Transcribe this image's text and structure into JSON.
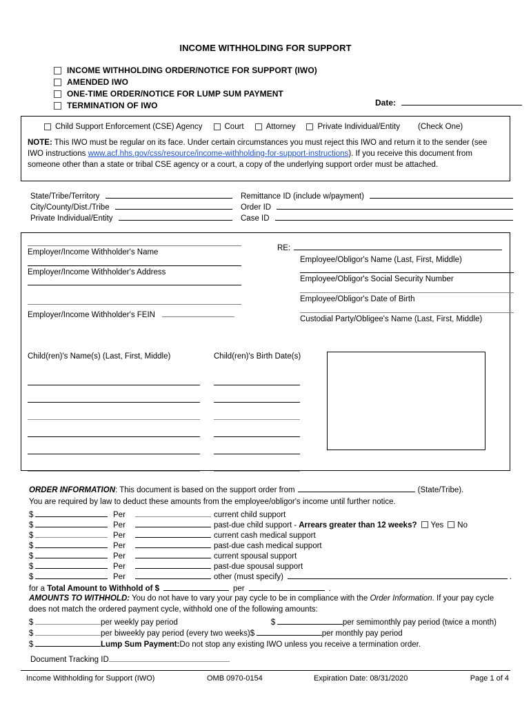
{
  "document": {
    "title": "INCOME WITHHOLDING FOR SUPPORT"
  },
  "form_type_checkboxes": [
    {
      "label": "INCOME WITHHOLDING ORDER/NOTICE FOR SUPPORT (IWO)",
      "checked": false
    },
    {
      "label": "AMENDED IWO",
      "checked": false
    },
    {
      "label": "ONE-TIME ORDER/NOTICE FOR LUMP SUM PAYMENT",
      "checked": false
    },
    {
      "label": "TERMINATION OF IWO",
      "checked": false
    }
  ],
  "date_field": {
    "label": "Date:",
    "value": ""
  },
  "sender_type": {
    "options": [
      "Child Support Enforcement (CSE) Agency",
      "Court",
      "Attorney",
      "Private Individual/Entity"
    ],
    "hint": "(Check One)"
  },
  "note": {
    "label": "NOTE:",
    "part1": "  This IWO must be regular on its face.  Under certain circumstances you must reject this IWO and return it to the sender (see IWO instructions ",
    "link": "www.acf.hhs.gov/css/resource/income-withholding-for-support-instructions",
    "part2": "). If you receive this document from someone other than a state or tribal CSE agency or a court, a copy of the underlying support order must be attached."
  },
  "issuer_block": {
    "rows": [
      {
        "left_label": "State/Tribe/Territory",
        "left_value": "",
        "right_label": "Remittance ID (include w/payment)",
        "right_value": ""
      },
      {
        "left_label": "City/County/Dist./Tribe",
        "left_value": "",
        "right_label": "Order ID",
        "right_value": ""
      },
      {
        "left_label": "Private Individual/Entity",
        "left_value": "",
        "right_label": "Case ID",
        "right_value": ""
      }
    ]
  },
  "employer_block": {
    "left_fields": [
      {
        "label": "Employer/Income Withholder's Name",
        "value": ""
      },
      {
        "label": "Employer/Income Withholder's Address",
        "value": ""
      }
    ],
    "fein": {
      "label": "Employer/Income Withholder's FEIN",
      "value": ""
    },
    "re_label": "RE:",
    "re_value": "",
    "right_fields": [
      {
        "label": "Employee/Obligor's Name (Last, First, Middle)",
        "value": ""
      },
      {
        "label": "Employee/Obligor's Social Security Number",
        "value": ""
      },
      {
        "label": "Employee/Obligor's Date of Birth",
        "value": ""
      },
      {
        "label": "Custodial Party/Obligee's Name (Last, First, Middle)",
        "value": ""
      }
    ],
    "children": {
      "names_header": "Child(ren)'s Name(s) (Last, First, Middle)",
      "birthdates_header": "Child(ren)'s Birth Date(s)",
      "rows": [
        {
          "name": "",
          "birthdate": ""
        },
        {
          "name": "",
          "birthdate": ""
        },
        {
          "name": "",
          "birthdate": ""
        },
        {
          "name": "",
          "birthdate": ""
        },
        {
          "name": "",
          "birthdate": ""
        },
        {
          "name": "",
          "birthdate": ""
        }
      ]
    }
  },
  "order_information": {
    "heading": "ORDER INFORMATION",
    "intro_pre": ": This document is based on the support order from",
    "state_tribe_value": "",
    "intro_post": "(State/Tribe).",
    "line2": "You are required by law to deduct these amounts from the employee/obligor's income until further notice.",
    "per_label": "Per",
    "dollar_sign": "$",
    "rows": [
      {
        "amount": "",
        "frequency": "",
        "description": "current child support"
      },
      {
        "amount": "",
        "frequency": "",
        "description": "past-due child support -",
        "arrears_label": "Arrears greater than 12 weeks?",
        "yes_label": "Yes",
        "no_label": "No"
      },
      {
        "amount": "",
        "frequency": "",
        "description": "current cash medical support"
      },
      {
        "amount": "",
        "frequency": "",
        "description": "past-due cash medical support"
      },
      {
        "amount": "",
        "frequency": "",
        "description": "current spousal support"
      },
      {
        "amount": "",
        "frequency": "",
        "description": "past-due spousal support"
      },
      {
        "amount": "",
        "frequency": "",
        "description": "other (must specify)",
        "specify_value": ""
      }
    ],
    "total": {
      "prefix": "for a",
      "bold": "Total Amount to Withhold",
      "of": "of $",
      "amount": "",
      "per": "per",
      "frequency": "",
      "period": "."
    }
  },
  "amounts_to_withhold": {
    "heading": "AMOUNTS TO WITHHOLD:",
    "text_a": " You do not have to vary your pay cycle to be in compliance with the ",
    "text_italic": "Order Information",
    "text_b": ".  If your pay cycle does not match the ordered payment cycle, withhold one of the following amounts:",
    "dollar_sign": "$",
    "rows": [
      {
        "left_amount": "",
        "left_label": "per weekly pay period",
        "right_amount": "",
        "right_label": "per semimonthly pay period (twice a month)"
      },
      {
        "left_amount": "",
        "left_label": "per biweekly pay period (every two weeks)",
        "right_amount": "",
        "right_label": "per monthly pay period"
      }
    ],
    "lump_sum": {
      "amount": "",
      "bold_label": "Lump Sum Payment:",
      "text": " Do not stop any existing IWO unless you receive a termination order."
    }
  },
  "document_tracking": {
    "label": "Document Tracking ID",
    "value": ""
  },
  "footer": {
    "form_name": "Income Withholding for Support (IWO)",
    "omb": "OMB 0970-0154",
    "expiration": "Expiration Date: 08/31/2020",
    "page": "Page 1 of 4"
  },
  "colors": {
    "link": "#1a4fd6",
    "rule": "#000000",
    "light_rule": "#8b8b8b"
  }
}
